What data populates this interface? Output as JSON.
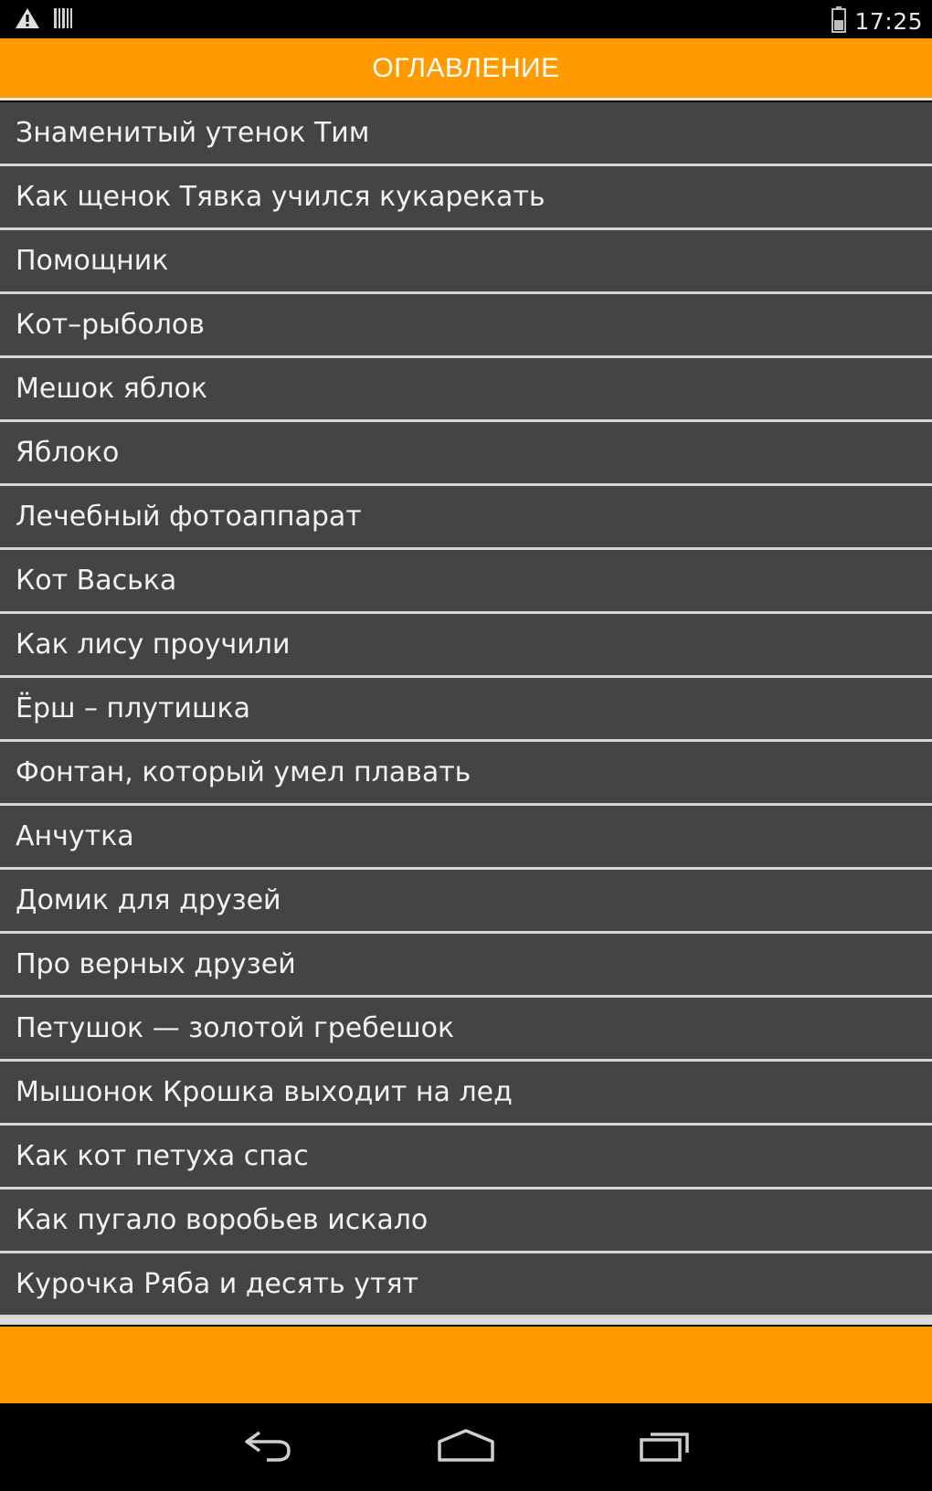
{
  "status_bar": {
    "time": "17:25",
    "icons": [
      "warning-icon",
      "barcode-icon",
      "battery-icon"
    ]
  },
  "header": {
    "title": "ОГЛАВЛЕНИЕ"
  },
  "toc": {
    "items": [
      "Знаменитый утенок Тим",
      "Как щенок Тявка учился кукарекать",
      "Помощник",
      "Кот–рыболов",
      "Мешок яблок",
      "Яблоко",
      "Лечебный фотоаппарат",
      "Кот Васька",
      "Как лису проучили",
      "Ёрш – плутишка",
      "Фонтан, который умел плавать",
      "Анчутка",
      "Домик для друзей",
      "Про верных друзей",
      "Петушок — золотой гребешок",
      "Мышонок Крошка выходит на лед",
      "Как кот петуха спас",
      "Как пугало воробьев искало",
      "Курочка Ряба и десять утят"
    ]
  },
  "nav_bar": {
    "buttons": [
      "back-icon",
      "home-icon",
      "recent-apps-icon"
    ]
  },
  "colors": {
    "accent": "#ff9a00",
    "list_bg": "#444444",
    "divider": "#d6d6d6",
    "text": "#f2f2f2"
  }
}
